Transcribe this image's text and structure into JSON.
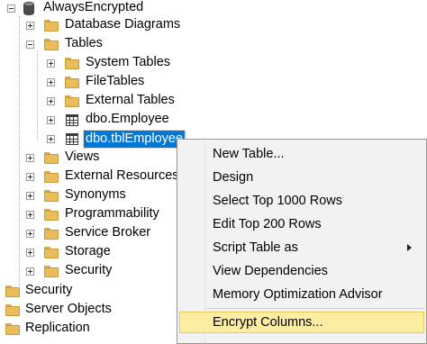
{
  "tree": {
    "database": "AlwaysEncrypted",
    "database_diagrams": "Database Diagrams",
    "tables": "Tables",
    "system_tables": "System Tables",
    "file_tables": "FileTables",
    "external_tables": "External Tables",
    "dbo_employee": "dbo.Employee",
    "dbo_tbl_employee": "dbo.tblEmployee",
    "views": "Views",
    "external_resources": "External Resources",
    "synonyms": "Synonyms",
    "programmability": "Programmability",
    "service_broker": "Service Broker",
    "storage": "Storage",
    "security_db": "Security",
    "security": "Security",
    "server_objects": "Server Objects",
    "replication": "Replication"
  },
  "context_menu": {
    "items": [
      {
        "label": "New Table..."
      },
      {
        "label": "Design"
      },
      {
        "label": "Select Top 1000 Rows"
      },
      {
        "label": "Edit Top 200 Rows"
      },
      {
        "label": "Script Table as"
      },
      {
        "label": "View Dependencies"
      },
      {
        "label": "Memory Optimization Advisor"
      },
      {
        "label": "Encrypt Columns..."
      }
    ],
    "highlighted": "Encrypt Columns..."
  },
  "colors": {
    "selection": "#0078d7",
    "menu_highlight": "#fbeea3",
    "folder": "#e9bc5c"
  }
}
